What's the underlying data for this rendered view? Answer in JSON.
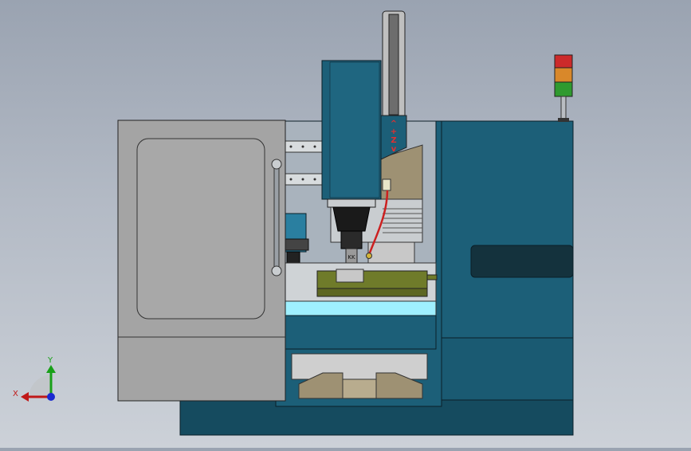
{
  "viewport": {
    "background_top": "#9aa3b1",
    "background_bottom": "#ccd1d8"
  },
  "colors": {
    "machine_body": "#1c5f78",
    "machine_body_light": "#226d87",
    "machine_base": "#154b5f",
    "door_grey": "#a4a4a4",
    "door_window": "#a8a8a8",
    "bed_cyan": "#9ff0ff",
    "vise_green": "#6f7b2a",
    "column_tan": "#9e9173",
    "hose_red": "#cc2020",
    "signal_red": "#cc2a2a",
    "signal_amber": "#d9882a",
    "signal_green": "#2f9a2f"
  },
  "z_axis_label": [
    "^",
    "+",
    "Z",
    "v"
  ],
  "triad": {
    "x_label": "X",
    "y_label": "Y",
    "x_color": "#c01818",
    "y_color": "#18a018",
    "z_color": "#1a2ad0"
  },
  "signal_tower": {
    "lights": [
      "red",
      "amber",
      "green"
    ]
  }
}
